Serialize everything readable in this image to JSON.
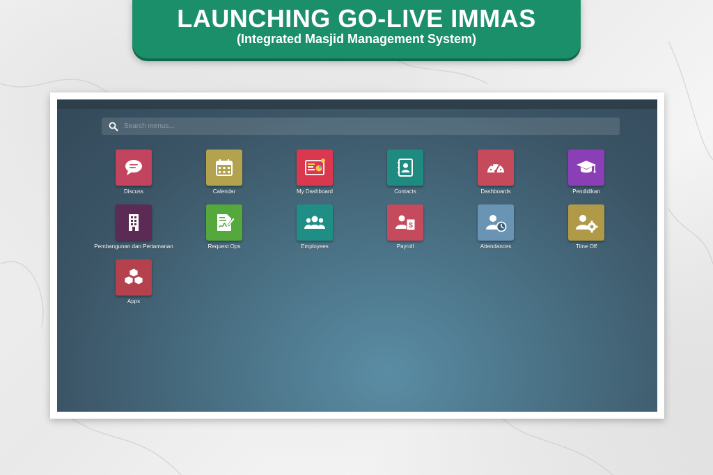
{
  "banner": {
    "title": "LAUNCHING GO-LIVE IMMAS",
    "subtitle": "(Integrated Masjid Management System)"
  },
  "search": {
    "placeholder": "Search menus...",
    "icon": "search-icon"
  },
  "apps": [
    {
      "label": "Discuss",
      "icon": "chat-bubble-icon",
      "color": "#c3445e"
    },
    {
      "label": "Calendar",
      "icon": "calendar-icon",
      "color": "#b3a24e"
    },
    {
      "label": "My Dashboard",
      "icon": "dashboard-chart-icon",
      "color": "#d9384e"
    },
    {
      "label": "Contacts",
      "icon": "address-book-icon",
      "color": "#1f8a80"
    },
    {
      "label": "Dashboards",
      "icon": "speedometer-icon",
      "color": "#c44a5c"
    },
    {
      "label": "Pendidikan",
      "icon": "graduation-cap-icon",
      "color": "#8a3fb6"
    },
    {
      "label": "Pembangunan dan Pertamanan",
      "icon": "building-icon",
      "color": "#5b2a55"
    },
    {
      "label": "Request Ops",
      "icon": "document-signature-icon",
      "color": "#55a83b"
    },
    {
      "label": "Employees",
      "icon": "users-group-icon",
      "color": "#1f8f86"
    },
    {
      "label": "Payroll",
      "icon": "payroll-icon",
      "color": "#c44a5c"
    },
    {
      "label": "Attendances",
      "icon": "user-clock-icon",
      "color": "#6a94b4"
    },
    {
      "label": "Time Off",
      "icon": "user-gear-icon",
      "color": "#b09a48"
    },
    {
      "label": "Apps",
      "icon": "cubes-icon",
      "color": "#b5414c"
    }
  ]
}
